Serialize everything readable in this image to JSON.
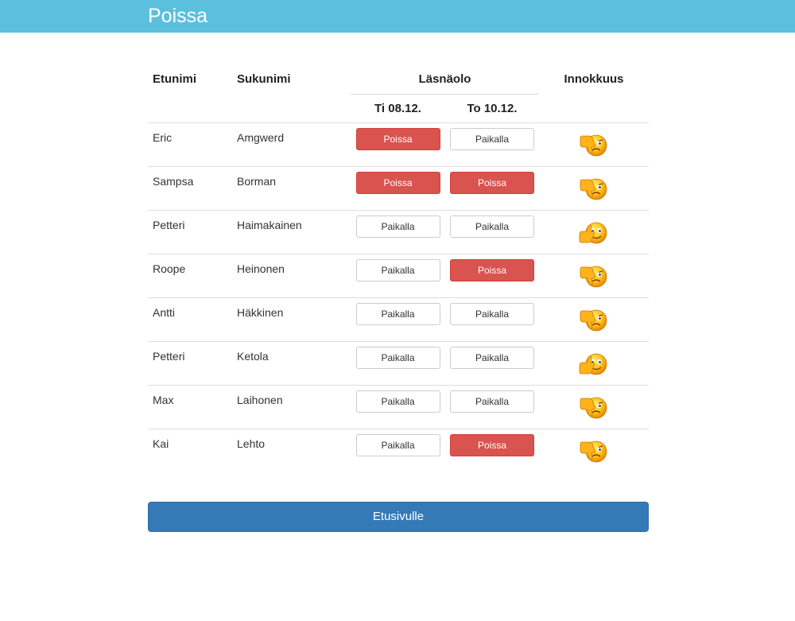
{
  "header": {
    "title": "Poissa"
  },
  "table": {
    "col_firstname": "Etunimi",
    "col_lastname": "Sukunimi",
    "col_attendance": "Läsnäolo",
    "col_enthusiasm": "Innokkuus",
    "dates": [
      "Ti 08.12.",
      "To 10.12."
    ],
    "rows": [
      {
        "firstname": "Eric",
        "lastname": "Amgwerd",
        "attendance": [
          "Poissa",
          "Paikalla"
        ],
        "enthusiasm": "thumbs-down-icon"
      },
      {
        "firstname": "Sampsa",
        "lastname": "Borman",
        "attendance": [
          "Poissa",
          "Poissa"
        ],
        "enthusiasm": "thumbs-down-icon"
      },
      {
        "firstname": "Petteri",
        "lastname": "Haimakainen",
        "attendance": [
          "Paikalla",
          "Paikalla"
        ],
        "enthusiasm": "thumbs-up-icon"
      },
      {
        "firstname": "Roope",
        "lastname": "Heinonen",
        "attendance": [
          "Paikalla",
          "Poissa"
        ],
        "enthusiasm": "thumbs-down-icon"
      },
      {
        "firstname": "Antti",
        "lastname": "Häkkinen",
        "attendance": [
          "Paikalla",
          "Paikalla"
        ],
        "enthusiasm": "thumbs-down-icon"
      },
      {
        "firstname": "Petteri",
        "lastname": "Ketola",
        "attendance": [
          "Paikalla",
          "Paikalla"
        ],
        "enthusiasm": "thumbs-up-icon"
      },
      {
        "firstname": "Max",
        "lastname": "Laihonen",
        "attendance": [
          "Paikalla",
          "Paikalla"
        ],
        "enthusiasm": "thumbs-down-icon"
      },
      {
        "firstname": "Kai",
        "lastname": "Lehto",
        "attendance": [
          "Paikalla",
          "Poissa"
        ],
        "enthusiasm": "thumbs-down-icon"
      }
    ]
  },
  "footer": {
    "home_button": "Etusivulle"
  },
  "colors": {
    "header": "#5bc0de",
    "absent": "#d9534f",
    "primary": "#337ab7"
  }
}
